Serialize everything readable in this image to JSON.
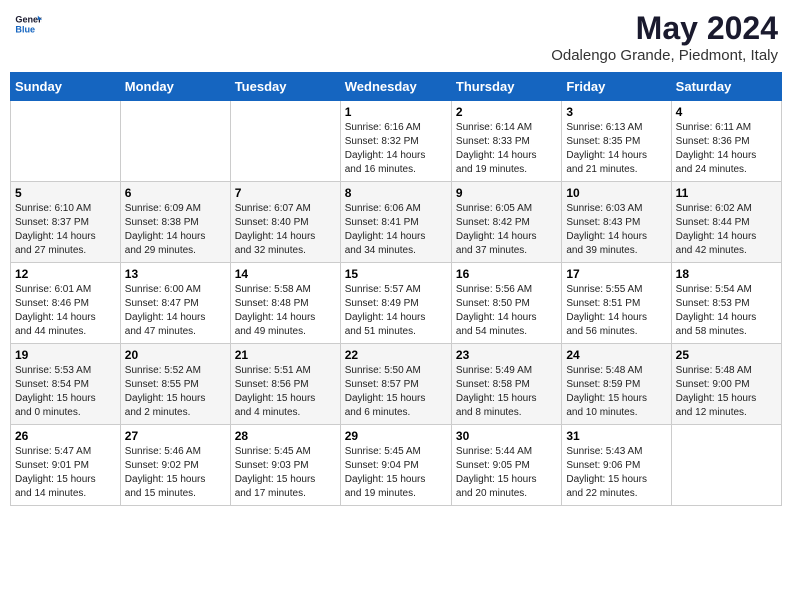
{
  "logo": {
    "line1": "General",
    "line2": "Blue"
  },
  "title": "May 2024",
  "subtitle": "Odalengo Grande, Piedmont, Italy",
  "days_of_week": [
    "Sunday",
    "Monday",
    "Tuesday",
    "Wednesday",
    "Thursday",
    "Friday",
    "Saturday"
  ],
  "weeks": [
    [
      {
        "day": "",
        "info": ""
      },
      {
        "day": "",
        "info": ""
      },
      {
        "day": "",
        "info": ""
      },
      {
        "day": "1",
        "info": "Sunrise: 6:16 AM\nSunset: 8:32 PM\nDaylight: 14 hours\nand 16 minutes."
      },
      {
        "day": "2",
        "info": "Sunrise: 6:14 AM\nSunset: 8:33 PM\nDaylight: 14 hours\nand 19 minutes."
      },
      {
        "day": "3",
        "info": "Sunrise: 6:13 AM\nSunset: 8:35 PM\nDaylight: 14 hours\nand 21 minutes."
      },
      {
        "day": "4",
        "info": "Sunrise: 6:11 AM\nSunset: 8:36 PM\nDaylight: 14 hours\nand 24 minutes."
      }
    ],
    [
      {
        "day": "5",
        "info": "Sunrise: 6:10 AM\nSunset: 8:37 PM\nDaylight: 14 hours\nand 27 minutes."
      },
      {
        "day": "6",
        "info": "Sunrise: 6:09 AM\nSunset: 8:38 PM\nDaylight: 14 hours\nand 29 minutes."
      },
      {
        "day": "7",
        "info": "Sunrise: 6:07 AM\nSunset: 8:40 PM\nDaylight: 14 hours\nand 32 minutes."
      },
      {
        "day": "8",
        "info": "Sunrise: 6:06 AM\nSunset: 8:41 PM\nDaylight: 14 hours\nand 34 minutes."
      },
      {
        "day": "9",
        "info": "Sunrise: 6:05 AM\nSunset: 8:42 PM\nDaylight: 14 hours\nand 37 minutes."
      },
      {
        "day": "10",
        "info": "Sunrise: 6:03 AM\nSunset: 8:43 PM\nDaylight: 14 hours\nand 39 minutes."
      },
      {
        "day": "11",
        "info": "Sunrise: 6:02 AM\nSunset: 8:44 PM\nDaylight: 14 hours\nand 42 minutes."
      }
    ],
    [
      {
        "day": "12",
        "info": "Sunrise: 6:01 AM\nSunset: 8:46 PM\nDaylight: 14 hours\nand 44 minutes."
      },
      {
        "day": "13",
        "info": "Sunrise: 6:00 AM\nSunset: 8:47 PM\nDaylight: 14 hours\nand 47 minutes."
      },
      {
        "day": "14",
        "info": "Sunrise: 5:58 AM\nSunset: 8:48 PM\nDaylight: 14 hours\nand 49 minutes."
      },
      {
        "day": "15",
        "info": "Sunrise: 5:57 AM\nSunset: 8:49 PM\nDaylight: 14 hours\nand 51 minutes."
      },
      {
        "day": "16",
        "info": "Sunrise: 5:56 AM\nSunset: 8:50 PM\nDaylight: 14 hours\nand 54 minutes."
      },
      {
        "day": "17",
        "info": "Sunrise: 5:55 AM\nSunset: 8:51 PM\nDaylight: 14 hours\nand 56 minutes."
      },
      {
        "day": "18",
        "info": "Sunrise: 5:54 AM\nSunset: 8:53 PM\nDaylight: 14 hours\nand 58 minutes."
      }
    ],
    [
      {
        "day": "19",
        "info": "Sunrise: 5:53 AM\nSunset: 8:54 PM\nDaylight: 15 hours\nand 0 minutes."
      },
      {
        "day": "20",
        "info": "Sunrise: 5:52 AM\nSunset: 8:55 PM\nDaylight: 15 hours\nand 2 minutes."
      },
      {
        "day": "21",
        "info": "Sunrise: 5:51 AM\nSunset: 8:56 PM\nDaylight: 15 hours\nand 4 minutes."
      },
      {
        "day": "22",
        "info": "Sunrise: 5:50 AM\nSunset: 8:57 PM\nDaylight: 15 hours\nand 6 minutes."
      },
      {
        "day": "23",
        "info": "Sunrise: 5:49 AM\nSunset: 8:58 PM\nDaylight: 15 hours\nand 8 minutes."
      },
      {
        "day": "24",
        "info": "Sunrise: 5:48 AM\nSunset: 8:59 PM\nDaylight: 15 hours\nand 10 minutes."
      },
      {
        "day": "25",
        "info": "Sunrise: 5:48 AM\nSunset: 9:00 PM\nDaylight: 15 hours\nand 12 minutes."
      }
    ],
    [
      {
        "day": "26",
        "info": "Sunrise: 5:47 AM\nSunset: 9:01 PM\nDaylight: 15 hours\nand 14 minutes."
      },
      {
        "day": "27",
        "info": "Sunrise: 5:46 AM\nSunset: 9:02 PM\nDaylight: 15 hours\nand 15 minutes."
      },
      {
        "day": "28",
        "info": "Sunrise: 5:45 AM\nSunset: 9:03 PM\nDaylight: 15 hours\nand 17 minutes."
      },
      {
        "day": "29",
        "info": "Sunrise: 5:45 AM\nSunset: 9:04 PM\nDaylight: 15 hours\nand 19 minutes."
      },
      {
        "day": "30",
        "info": "Sunrise: 5:44 AM\nSunset: 9:05 PM\nDaylight: 15 hours\nand 20 minutes."
      },
      {
        "day": "31",
        "info": "Sunrise: 5:43 AM\nSunset: 9:06 PM\nDaylight: 15 hours\nand 22 minutes."
      },
      {
        "day": "",
        "info": ""
      }
    ]
  ]
}
